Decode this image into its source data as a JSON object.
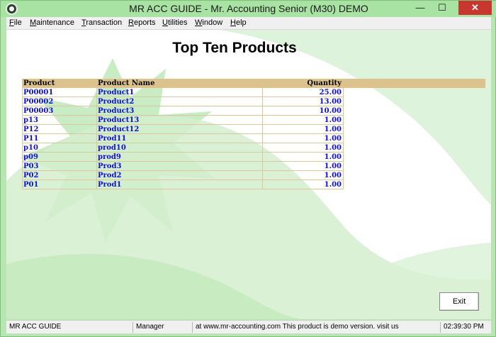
{
  "window": {
    "title": "MR ACC GUIDE - Mr. Accounting Senior (M30) DEMO",
    "minimize_glyph": "—",
    "maximize_glyph": "☐",
    "close_glyph": "✕"
  },
  "menu": [
    {
      "label": "File",
      "accel": "F",
      "rest": "ile"
    },
    {
      "label": "Maintenance",
      "accel": "M",
      "rest": "aintenance"
    },
    {
      "label": "Transaction",
      "accel": "T",
      "rest": "ransaction"
    },
    {
      "label": "Reports",
      "accel": "R",
      "rest": "eports"
    },
    {
      "label": "Utilities",
      "accel": "U",
      "rest": "tilities"
    },
    {
      "label": "Window",
      "accel": "W",
      "rest": "indow"
    },
    {
      "label": "Help",
      "accel": "H",
      "rest": "elp"
    }
  ],
  "report": {
    "title": "Top Ten Products",
    "columns": {
      "code": "Product",
      "name": "Product Name",
      "qty": "Quantity"
    },
    "rows": [
      {
        "code": "P00001",
        "name": "Product1",
        "qty": "25.00"
      },
      {
        "code": "P00002",
        "name": "Product2",
        "qty": "13.00"
      },
      {
        "code": "P00003",
        "name": "Product3",
        "qty": "10.00"
      },
      {
        "code": "p13",
        "name": "Product13",
        "qty": "1.00"
      },
      {
        "code": "P12",
        "name": "Product12",
        "qty": "1.00"
      },
      {
        "code": "P11",
        "name": "Prod11",
        "qty": "1.00"
      },
      {
        "code": "p10",
        "name": "prod10",
        "qty": "1.00"
      },
      {
        "code": "p09",
        "name": "prod9",
        "qty": "1.00"
      },
      {
        "code": "P03",
        "name": "Prod3",
        "qty": "1.00"
      },
      {
        "code": "P02",
        "name": "Prod2",
        "qty": "1.00"
      },
      {
        "code": "P01",
        "name": "Prod1",
        "qty": "1.00"
      }
    ]
  },
  "buttons": {
    "exit": "Exit"
  },
  "statusbar": {
    "app": "MR ACC GUIDE",
    "user": "Manager",
    "message": "at www.mr-accounting.com This product is demo version.  visit us",
    "time": "02:39:30 PM"
  },
  "colors": {
    "header_bg": "#dcc28c",
    "row_text": "#1010d0",
    "frame": "#b8e6b3"
  }
}
